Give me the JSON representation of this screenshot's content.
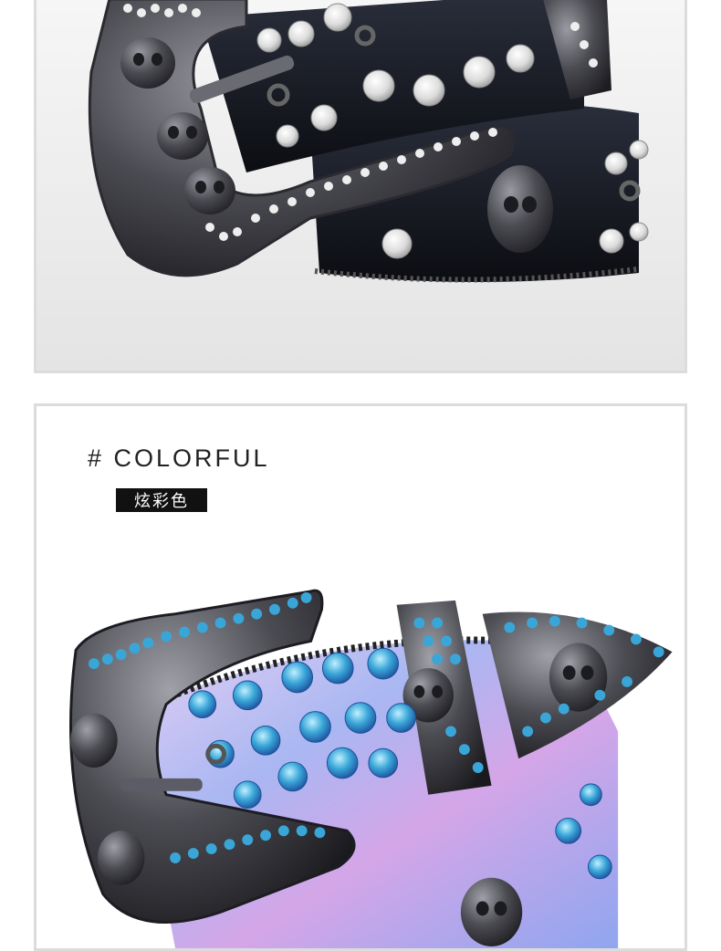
{
  "section": {
    "heading": "# COLORFUL",
    "tag": "炫彩色"
  },
  "colors": {
    "black_belt_bg": "#f2f2f2",
    "black_belt_leather": "#14161c",
    "clear_stone": "#e8e8e8",
    "gunmetal": "#4b4b52",
    "blue_stone": "#3aa6d8",
    "holo_leather": "#b8a8ee",
    "tag_bg": "#111111"
  },
  "photos": {
    "top": {
      "subject": "black-belt-clear-rhinestone-photo"
    },
    "bottom": {
      "subject": "holographic-belt-blue-rhinestone-photo"
    }
  }
}
